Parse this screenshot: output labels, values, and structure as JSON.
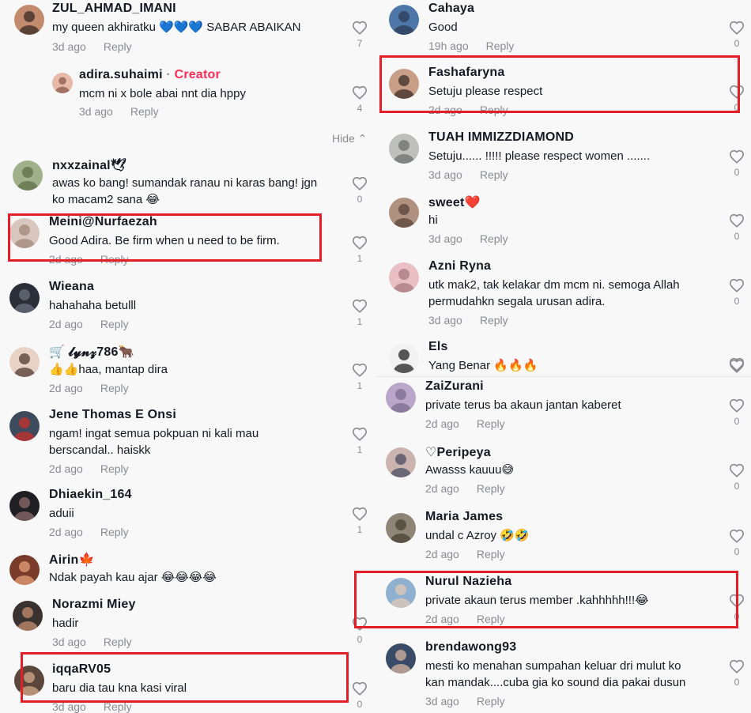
{
  "left": [
    {
      "name": "ZUL_AHMAD_IMANI",
      "text": "my queen akhiratku 💙💙💙 SABAR ABAIKAN",
      "time": "3d ago",
      "reply": "Reply",
      "likes": "7",
      "av": "#c28b6e",
      "av2": "#3a2a24"
    },
    {
      "name": "adira.suhaimi",
      "badge": "Creator",
      "text": "mcm ni x bole abai nnt dia hppy",
      "time": "3d ago",
      "reply": "Reply",
      "likes": "4",
      "av": "#e7b9a9",
      "av2": "#8b5a4a"
    },
    {
      "name": "nxxzainal🕊",
      "text": "awas ko bang! sumandak ranau ni karas bang! jgn",
      "text2": "ko macam2 sana 😂",
      "time": "",
      "reply": "",
      "likes": "0",
      "av": "#9fb08a",
      "av2": "#5f7044"
    },
    {
      "name": "Meini@Nurfaezah",
      "text": "Good Adira. Be firm when u need to be firm.",
      "time": "2d ago",
      "reply": "Reply",
      "likes": "1",
      "av": "#d9c7bf",
      "av2": "#a0877b"
    },
    {
      "name": "Wieana",
      "text": "hahahaha betulll",
      "time": "2d ago",
      "reply": "Reply",
      "likes": "1",
      "av": "#2b2f3a",
      "av2": "#6b7080"
    },
    {
      "name": "🛒 𝓵𝔂𝓷𝔃786🐂",
      "text": "👍👍haa, mantap dira",
      "time": "2d ago",
      "reply": "Reply",
      "likes": "1",
      "av": "#e8d2c6",
      "av2": "#503a33"
    },
    {
      "name": "Jene Thomas E Onsi",
      "text": "ngam! ingat semua pokpuan ni kali mau",
      "text2": "berscandal.. haiskk",
      "time": "2d ago",
      "reply": "Reply",
      "likes": "1",
      "av": "#3d4b5c",
      "av2": "#c9302c"
    },
    {
      "name": "Dhiaekin_164",
      "text": "aduii",
      "time": "2d ago",
      "reply": "Reply",
      "likes": "1",
      "av": "#1f1f24",
      "av2": "#8c6e6a"
    },
    {
      "name": "Airin🍁",
      "text": "Ndak payah kau ajar 😂😂😂😂",
      "time": "",
      "reply": "",
      "likes": "",
      "av": "#7a3b2a",
      "av2": "#e3a078"
    },
    {
      "name": "Norazmi Miey",
      "text": "hadir",
      "time": "3d ago",
      "reply": "Reply",
      "likes": "0",
      "av": "#3a3230",
      "av2": "#c48e6e"
    },
    {
      "name": "iqqaRV05",
      "text": "baru dia tau kna kasi viral",
      "time": "3d ago",
      "reply": "Reply",
      "likes": "0",
      "av": "#5a463a",
      "av2": "#d6a98a"
    }
  ],
  "right": [
    {
      "name": "Cahaya",
      "text": "Good",
      "time": "19h ago",
      "reply": "Reply",
      "likes": "0",
      "av": "#4d77a8",
      "av2": "#2b3b55"
    },
    {
      "name": "Fashafaryna",
      "text": "Setuju please respect",
      "time": "2d ago",
      "reply": "Reply",
      "likes": "0",
      "av": "#c89f86",
      "av2": "#3e2d27"
    },
    {
      "name": "TUAH IMMIZZDIAMOND",
      "text": "Setuju...... !!!!! please respect women .......",
      "time": "3d ago",
      "reply": "Reply",
      "likes": "0",
      "av": "#bfc0bd",
      "av2": "#6d6f70"
    },
    {
      "name": "sweet❤️",
      "text": "hi",
      "time": "3d ago",
      "reply": "Reply",
      "likes": "0",
      "av": "#b09180",
      "av2": "#5a4539"
    },
    {
      "name": "Azni Ryna",
      "text": "utk mak2, tak kelakar dm mcm ni. semoga Allah",
      "text2": "permudahkn segala urusan adira.",
      "time": "3d ago",
      "reply": "Reply",
      "likes": "0",
      "av": "#e9bfc4",
      "av2": "#a57a7f"
    },
    {
      "name": "Els",
      "text": "Yang Benar 🔥🔥🔥",
      "time": "",
      "reply": "",
      "likes": "",
      "av": "#f2f2f2",
      "av2": "#222222"
    },
    {
      "name": "ZaiZurani",
      "text": "private terus ba akaun jantan kaberet",
      "time": "2d ago",
      "reply": "Reply",
      "likes": "0",
      "av": "#b9a6c9",
      "av2": "#7c6b8f"
    },
    {
      "name": "♡Peripeya",
      "text": "Awasss kauuu😅",
      "time": "2d ago",
      "reply": "Reply",
      "likes": "0",
      "av": "#cbb3b0",
      "av2": "#4c4d63"
    },
    {
      "name": "Maria James",
      "text": "undal c Azroy 🤣🤣",
      "time": "2d ago",
      "reply": "Reply",
      "likes": "0",
      "av": "#8e8577",
      "av2": "#4a4235"
    },
    {
      "name": "Nurul Nazieha",
      "text": "private akaun terus member .kahhhhh!!!😂",
      "time": "2d ago",
      "reply": "Reply",
      "likes": "0",
      "av": "#8fb0cf",
      "av2": "#e0c8b8"
    },
    {
      "name": "brendawong93",
      "text": "mesti ko menahan sumpahan keluar dri mulut ko",
      "text2": "kan mandak....cuba gia ko sound dia pakai dusun",
      "time": "3d ago",
      "reply": "Reply",
      "likes": "0",
      "av": "#394b66",
      "av2": "#d6b4a0"
    }
  ],
  "hide_label": "Hide",
  "highlight_color": "#e41e26"
}
